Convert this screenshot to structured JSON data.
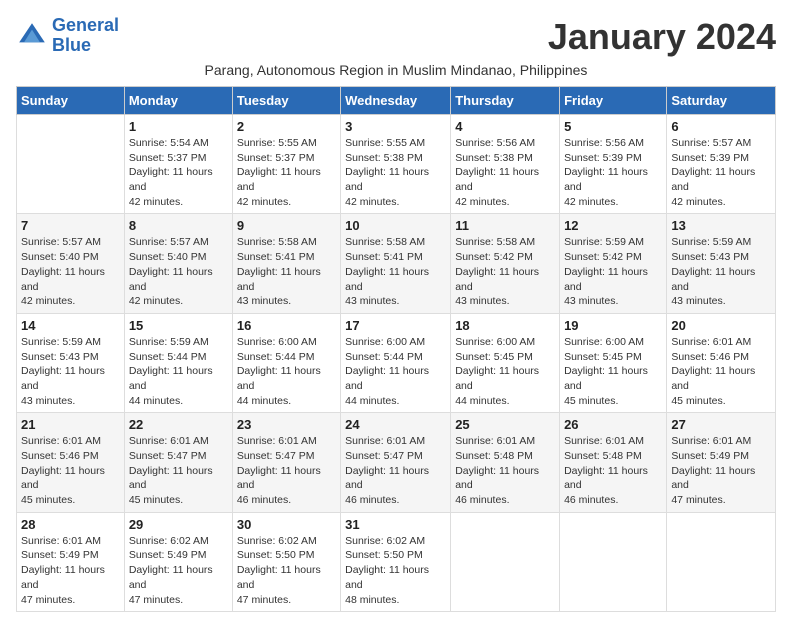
{
  "logo": {
    "line1": "General",
    "line2": "Blue"
  },
  "title": "January 2024",
  "subtitle": "Parang, Autonomous Region in Muslim Mindanao, Philippines",
  "days_of_week": [
    "Sunday",
    "Monday",
    "Tuesday",
    "Wednesday",
    "Thursday",
    "Friday",
    "Saturday"
  ],
  "weeks": [
    [
      {
        "day": "",
        "sunrise": "",
        "sunset": "",
        "daylight": ""
      },
      {
        "day": "1",
        "sunrise": "Sunrise: 5:54 AM",
        "sunset": "Sunset: 5:37 PM",
        "daylight": "Daylight: 11 hours and 42 minutes."
      },
      {
        "day": "2",
        "sunrise": "Sunrise: 5:55 AM",
        "sunset": "Sunset: 5:37 PM",
        "daylight": "Daylight: 11 hours and 42 minutes."
      },
      {
        "day": "3",
        "sunrise": "Sunrise: 5:55 AM",
        "sunset": "Sunset: 5:38 PM",
        "daylight": "Daylight: 11 hours and 42 minutes."
      },
      {
        "day": "4",
        "sunrise": "Sunrise: 5:56 AM",
        "sunset": "Sunset: 5:38 PM",
        "daylight": "Daylight: 11 hours and 42 minutes."
      },
      {
        "day": "5",
        "sunrise": "Sunrise: 5:56 AM",
        "sunset": "Sunset: 5:39 PM",
        "daylight": "Daylight: 11 hours and 42 minutes."
      },
      {
        "day": "6",
        "sunrise": "Sunrise: 5:57 AM",
        "sunset": "Sunset: 5:39 PM",
        "daylight": "Daylight: 11 hours and 42 minutes."
      }
    ],
    [
      {
        "day": "7",
        "sunrise": "Sunrise: 5:57 AM",
        "sunset": "Sunset: 5:40 PM",
        "daylight": "Daylight: 11 hours and 42 minutes."
      },
      {
        "day": "8",
        "sunrise": "Sunrise: 5:57 AM",
        "sunset": "Sunset: 5:40 PM",
        "daylight": "Daylight: 11 hours and 42 minutes."
      },
      {
        "day": "9",
        "sunrise": "Sunrise: 5:58 AM",
        "sunset": "Sunset: 5:41 PM",
        "daylight": "Daylight: 11 hours and 43 minutes."
      },
      {
        "day": "10",
        "sunrise": "Sunrise: 5:58 AM",
        "sunset": "Sunset: 5:41 PM",
        "daylight": "Daylight: 11 hours and 43 minutes."
      },
      {
        "day": "11",
        "sunrise": "Sunrise: 5:58 AM",
        "sunset": "Sunset: 5:42 PM",
        "daylight": "Daylight: 11 hours and 43 minutes."
      },
      {
        "day": "12",
        "sunrise": "Sunrise: 5:59 AM",
        "sunset": "Sunset: 5:42 PM",
        "daylight": "Daylight: 11 hours and 43 minutes."
      },
      {
        "day": "13",
        "sunrise": "Sunrise: 5:59 AM",
        "sunset": "Sunset: 5:43 PM",
        "daylight": "Daylight: 11 hours and 43 minutes."
      }
    ],
    [
      {
        "day": "14",
        "sunrise": "Sunrise: 5:59 AM",
        "sunset": "Sunset: 5:43 PM",
        "daylight": "Daylight: 11 hours and 43 minutes."
      },
      {
        "day": "15",
        "sunrise": "Sunrise: 5:59 AM",
        "sunset": "Sunset: 5:44 PM",
        "daylight": "Daylight: 11 hours and 44 minutes."
      },
      {
        "day": "16",
        "sunrise": "Sunrise: 6:00 AM",
        "sunset": "Sunset: 5:44 PM",
        "daylight": "Daylight: 11 hours and 44 minutes."
      },
      {
        "day": "17",
        "sunrise": "Sunrise: 6:00 AM",
        "sunset": "Sunset: 5:44 PM",
        "daylight": "Daylight: 11 hours and 44 minutes."
      },
      {
        "day": "18",
        "sunrise": "Sunrise: 6:00 AM",
        "sunset": "Sunset: 5:45 PM",
        "daylight": "Daylight: 11 hours and 44 minutes."
      },
      {
        "day": "19",
        "sunrise": "Sunrise: 6:00 AM",
        "sunset": "Sunset: 5:45 PM",
        "daylight": "Daylight: 11 hours and 45 minutes."
      },
      {
        "day": "20",
        "sunrise": "Sunrise: 6:01 AM",
        "sunset": "Sunset: 5:46 PM",
        "daylight": "Daylight: 11 hours and 45 minutes."
      }
    ],
    [
      {
        "day": "21",
        "sunrise": "Sunrise: 6:01 AM",
        "sunset": "Sunset: 5:46 PM",
        "daylight": "Daylight: 11 hours and 45 minutes."
      },
      {
        "day": "22",
        "sunrise": "Sunrise: 6:01 AM",
        "sunset": "Sunset: 5:47 PM",
        "daylight": "Daylight: 11 hours and 45 minutes."
      },
      {
        "day": "23",
        "sunrise": "Sunrise: 6:01 AM",
        "sunset": "Sunset: 5:47 PM",
        "daylight": "Daylight: 11 hours and 46 minutes."
      },
      {
        "day": "24",
        "sunrise": "Sunrise: 6:01 AM",
        "sunset": "Sunset: 5:47 PM",
        "daylight": "Daylight: 11 hours and 46 minutes."
      },
      {
        "day": "25",
        "sunrise": "Sunrise: 6:01 AM",
        "sunset": "Sunset: 5:48 PM",
        "daylight": "Daylight: 11 hours and 46 minutes."
      },
      {
        "day": "26",
        "sunrise": "Sunrise: 6:01 AM",
        "sunset": "Sunset: 5:48 PM",
        "daylight": "Daylight: 11 hours and 46 minutes."
      },
      {
        "day": "27",
        "sunrise": "Sunrise: 6:01 AM",
        "sunset": "Sunset: 5:49 PM",
        "daylight": "Daylight: 11 hours and 47 minutes."
      }
    ],
    [
      {
        "day": "28",
        "sunrise": "Sunrise: 6:01 AM",
        "sunset": "Sunset: 5:49 PM",
        "daylight": "Daylight: 11 hours and 47 minutes."
      },
      {
        "day": "29",
        "sunrise": "Sunrise: 6:02 AM",
        "sunset": "Sunset: 5:49 PM",
        "daylight": "Daylight: 11 hours and 47 minutes."
      },
      {
        "day": "30",
        "sunrise": "Sunrise: 6:02 AM",
        "sunset": "Sunset: 5:50 PM",
        "daylight": "Daylight: 11 hours and 47 minutes."
      },
      {
        "day": "31",
        "sunrise": "Sunrise: 6:02 AM",
        "sunset": "Sunset: 5:50 PM",
        "daylight": "Daylight: 11 hours and 48 minutes."
      },
      {
        "day": "",
        "sunrise": "",
        "sunset": "",
        "daylight": ""
      },
      {
        "day": "",
        "sunrise": "",
        "sunset": "",
        "daylight": ""
      },
      {
        "day": "",
        "sunrise": "",
        "sunset": "",
        "daylight": ""
      }
    ]
  ]
}
